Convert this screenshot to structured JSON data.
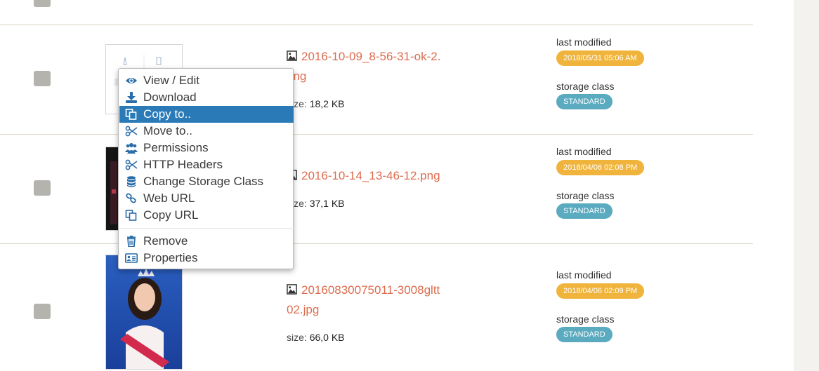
{
  "rows": [
    {
      "file_name_line1": "2016-10-09_8-56-31-ok-2.",
      "file_name_line2": "png",
      "size_label": "size:",
      "size_value": "18,2 KB",
      "modified_label": "last modified",
      "modified_value": "2018/05/31 05:06 AM",
      "storage_label": "storage class",
      "storage_value": "STANDARD"
    },
    {
      "file_name_line1": "2016-10-14_13-46-12.png",
      "size_label": "size:",
      "size_value": "37,1 KB",
      "modified_label": "last modified",
      "modified_value": "2018/04/06 02:08 PM",
      "storage_label": "storage class",
      "storage_value": "STANDARD"
    },
    {
      "file_name_line1": "20160830075011-3008gltt",
      "file_name_line2": "02.jpg",
      "size_label": "size:",
      "size_value": "66,0 KB",
      "modified_label": "last modified",
      "modified_value": "2018/04/06 02:09 PM",
      "storage_label": "storage class",
      "storage_value": "STANDARD"
    }
  ],
  "context_menu": {
    "items": [
      {
        "label": "View / Edit",
        "icon": "eye-icon"
      },
      {
        "label": "Download",
        "icon": "download-icon"
      },
      {
        "label": "Copy to..",
        "icon": "copy-icon",
        "active": true
      },
      {
        "label": "Move to..",
        "icon": "scissors-icon"
      },
      {
        "label": "Permissions",
        "icon": "users-icon"
      },
      {
        "label": "HTTP Headers",
        "icon": "scissors-icon"
      },
      {
        "label": "Change Storage Class",
        "icon": "database-icon"
      },
      {
        "label": "Web URL",
        "icon": "link-icon"
      },
      {
        "label": "Copy URL",
        "icon": "copy-icon"
      },
      {
        "label": "Remove",
        "icon": "trash-icon"
      },
      {
        "label": "Properties",
        "icon": "id-card-icon"
      }
    ]
  },
  "colors": {
    "accent": "#2a7ab8",
    "link": "#dd6c4f",
    "date_badge": "#f0b43c",
    "storage_badge": "#5aaac0"
  }
}
